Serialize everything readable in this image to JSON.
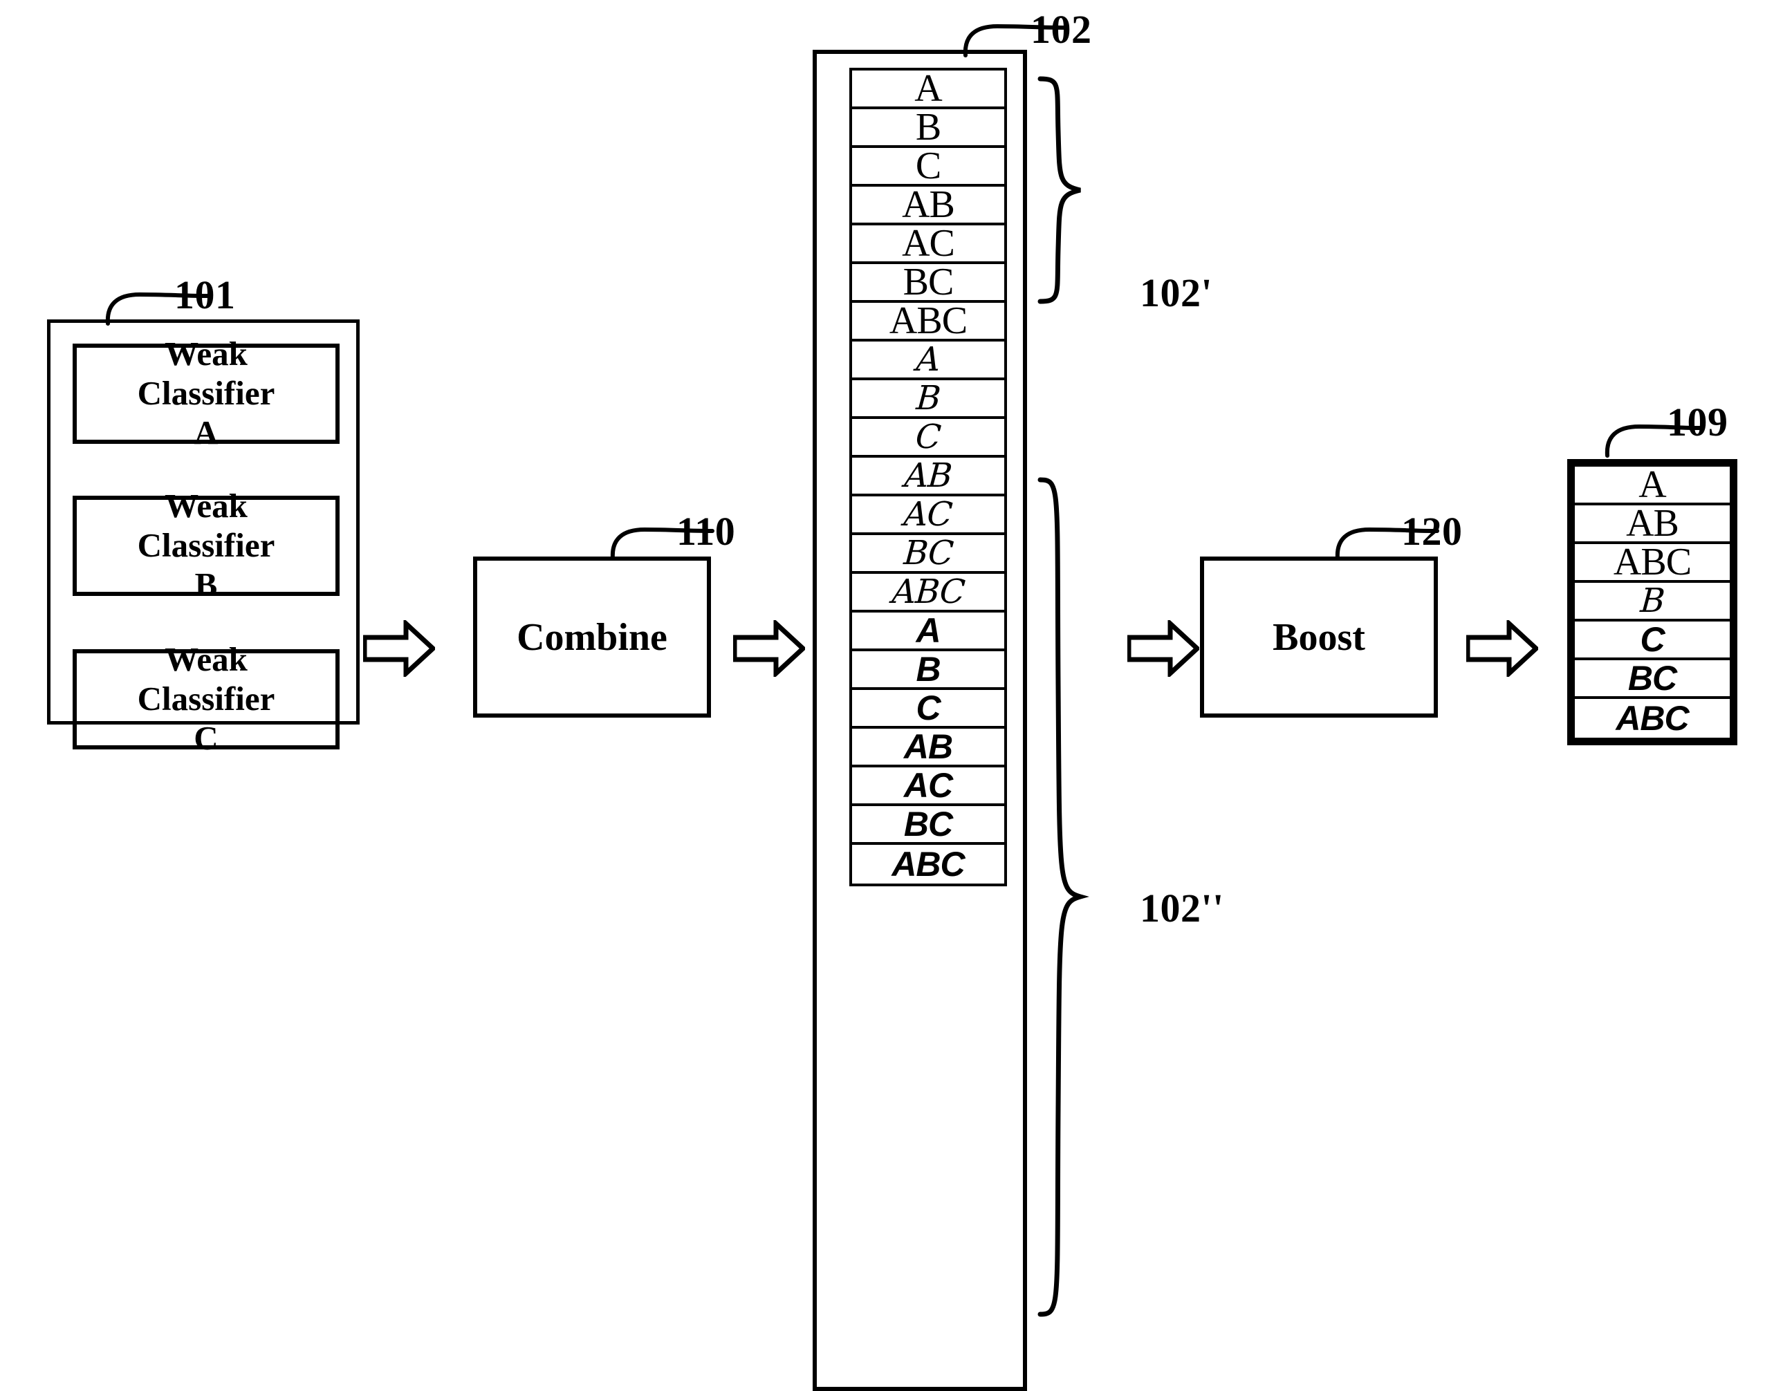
{
  "figure": {
    "title": "Weak classifier combination and boosting block diagram",
    "line_color": "#000000",
    "background": "#ffffff"
  },
  "refs": {
    "weak_classifier_group": "101",
    "feature_pool": "102",
    "pool_group_first": "102'",
    "pool_group_second": "102''",
    "combine_stage": "110",
    "boost_stage": "120",
    "output_set": "109"
  },
  "weak_classifiers": {
    "ref": "101",
    "items": [
      {
        "line1": "Weak",
        "line2": "Classifier",
        "line3": "A"
      },
      {
        "line1": "Weak",
        "line2": "Classifier",
        "line3": "B"
      },
      {
        "line1": "Weak",
        "line2": "Classifier",
        "line3": "C"
      }
    ]
  },
  "stages": {
    "combine": {
      "label": "Combine",
      "ref": "110"
    },
    "boost": {
      "label": "Boost",
      "ref": "120"
    }
  },
  "arrows": {
    "glyph": "block-arrow-right",
    "count": 4,
    "direction": "right"
  },
  "feature_pool": {
    "ref": "102",
    "groups": [
      {
        "ref": "102'",
        "style": "roman",
        "rows": [
          "A",
          "B",
          "C",
          "AB",
          "AC",
          "BC",
          "ABC"
        ]
      },
      {
        "ref": "102''",
        "style": "script",
        "rows": [
          "A",
          "B",
          "C",
          "AB",
          "AC",
          "BC",
          "ABC"
        ]
      },
      {
        "ref": "102''",
        "style": "bold-italic-sans",
        "rows": [
          "A",
          "B",
          "C",
          "AB",
          "AC",
          "BC",
          "ABC"
        ]
      }
    ]
  },
  "output_set": {
    "ref": "109",
    "rows": [
      {
        "text": "A",
        "style": "roman"
      },
      {
        "text": "AB",
        "style": "roman"
      },
      {
        "text": "ABC",
        "style": "roman"
      },
      {
        "text": "B",
        "style": "script"
      },
      {
        "text": "C",
        "style": "bold-italic-sans"
      },
      {
        "text": "BC",
        "style": "bold-italic-sans"
      },
      {
        "text": "ABC",
        "style": "bold-italic-sans"
      }
    ]
  }
}
